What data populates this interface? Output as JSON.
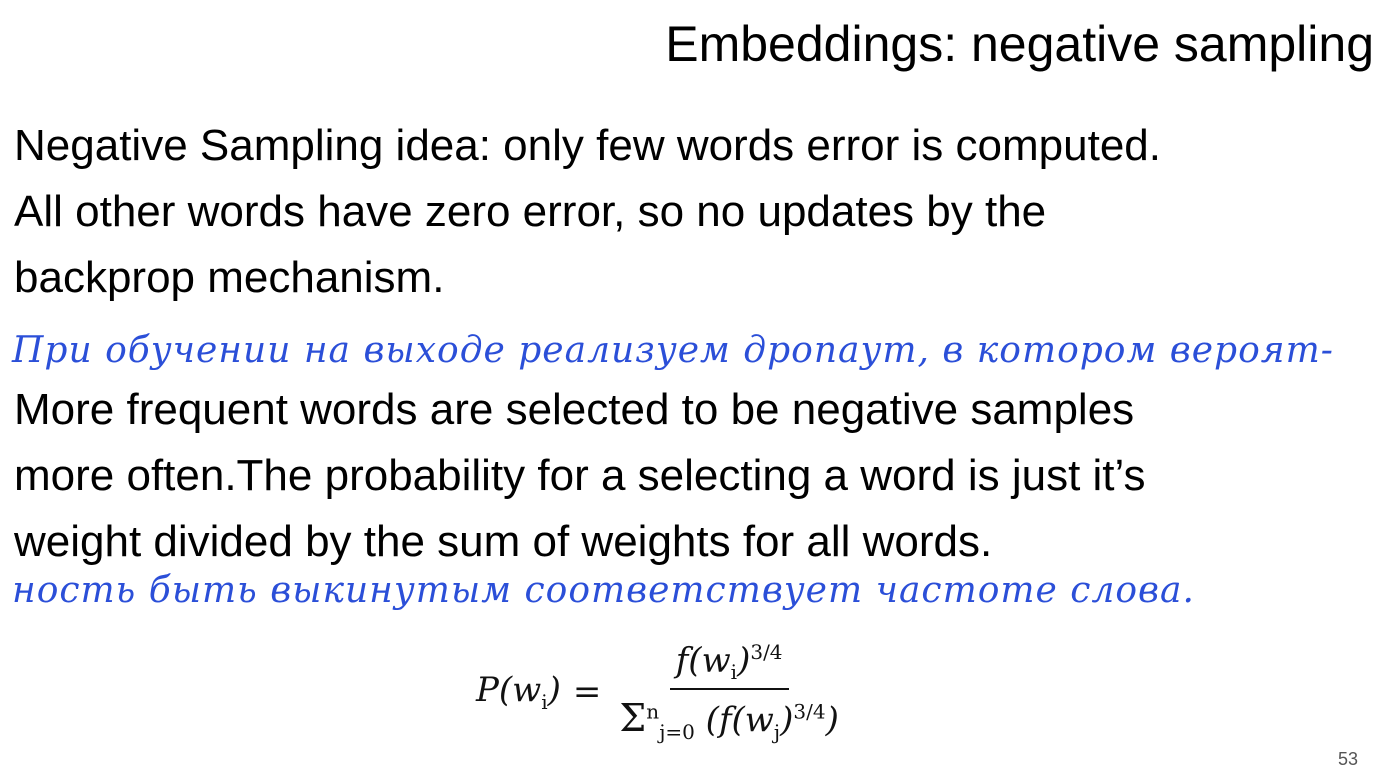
{
  "slide": {
    "title": "Embeddings: negative sampling",
    "paragraph1": [
      "Negative Sampling idea: only few words error is computed.",
      "All other words have zero error, so no updates by the",
      "backprop mechanism."
    ],
    "paragraph2": [
      "More frequent words are selected to be negative samples",
      "more often.The probability for a selecting a word is just it’s",
      "weight divided by the sum of weights for all words."
    ],
    "handwritten_notes": [
      "При обучении на выходе реализуем дропаут, в котором вероят-",
      "ность быть выкинутым соответствует частоте слова."
    ],
    "formula": {
      "lhs": "P(w",
      "lhs_sub": "i",
      "lhs_close": ")",
      "equals": "=",
      "numerator": "f(w",
      "numerator_sub": "i",
      "numerator_close": ")",
      "numerator_exp": "3/4",
      "denominator_sum": "Σ",
      "denominator_sum_sup": "n",
      "denominator_sum_sub": "j=0",
      "denominator_open": " (f(w",
      "denominator_sub": "j",
      "denominator_mid": ")",
      "denominator_exp": "3/4",
      "denominator_close": ")"
    },
    "page_number": "53"
  }
}
